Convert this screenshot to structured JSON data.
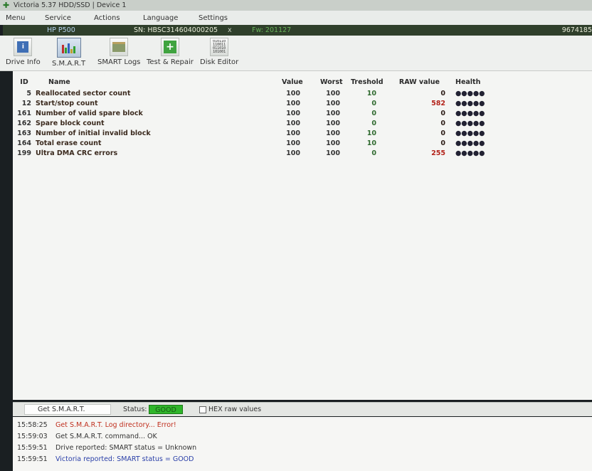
{
  "window": {
    "title": "Victoria 5.37 HDD/SSD | Device 1"
  },
  "menu": [
    "Menu",
    "Service",
    "Actions",
    "Language",
    "Settings"
  ],
  "device_bar": {
    "model": "HP P500",
    "serial": "SN: HBSC314604000205",
    "close": "x",
    "firmware": "Fw: 201127",
    "capacity": "9674185"
  },
  "toolbar": [
    {
      "label": "Drive Info",
      "icon": "drive-info-icon"
    },
    {
      "label": "S.M.A.R.T",
      "icon": "smart-chart-icon",
      "active": true
    },
    {
      "label": "SMART Logs",
      "icon": "smart-logs-icon"
    },
    {
      "label": "Test & Repair",
      "icon": "test-repair-icon"
    },
    {
      "label": "Disk Editor",
      "icon": "disk-editor-icon"
    }
  ],
  "smart_table": {
    "headers": [
      "ID",
      "Name",
      "Value",
      "Worst",
      "Treshold",
      "RAW value",
      "Health"
    ],
    "rows": [
      {
        "id": "5",
        "name": "Reallocated sector count",
        "value": "100",
        "worst": "100",
        "threshold": "10",
        "raw": "0",
        "health": "●●●●●"
      },
      {
        "id": "12",
        "name": "Start/stop count",
        "value": "100",
        "worst": "100",
        "threshold": "0",
        "raw": "582",
        "health": "●●●●●"
      },
      {
        "id": "161",
        "name": "Number of valid spare block",
        "value": "100",
        "worst": "100",
        "threshold": "0",
        "raw": "0",
        "health": "●●●●●"
      },
      {
        "id": "162",
        "name": "Spare block count",
        "value": "100",
        "worst": "100",
        "threshold": "0",
        "raw": "0",
        "health": "●●●●●"
      },
      {
        "id": "163",
        "name": "Number of initial invalid block",
        "value": "100",
        "worst": "100",
        "threshold": "10",
        "raw": "0",
        "health": "●●●●●"
      },
      {
        "id": "164",
        "name": "Total erase count",
        "value": "100",
        "worst": "100",
        "threshold": "10",
        "raw": "0",
        "health": "●●●●●"
      },
      {
        "id": "199",
        "name": "Ultra DMA CRC errors",
        "value": "100",
        "worst": "100",
        "threshold": "0",
        "raw": "255",
        "health": "●●●●●"
      }
    ]
  },
  "bottom": {
    "get_smart": "Get S.M.A.R.T.",
    "status_label": "Status:",
    "status_value": "GOOD",
    "hex_label": "HEX raw values"
  },
  "log": [
    {
      "time": "15:58:25",
      "msg": "Get S.M.A.R.T. Log directory... Error!",
      "kind": "err"
    },
    {
      "time": "15:59:03",
      "msg": "Get S.M.A.R.T. command... OK",
      "kind": "normal"
    },
    {
      "time": "15:59:51",
      "msg": "Drive reported: SMART status = Unknown",
      "kind": "normal"
    },
    {
      "time": "15:59:51",
      "msg": "Victoria reported: SMART status = GOOD",
      "kind": "blue"
    }
  ],
  "colors": {
    "status_good": "#2fb52a",
    "device_bar": "#2f3f2b",
    "error_text": "#c0301f"
  }
}
